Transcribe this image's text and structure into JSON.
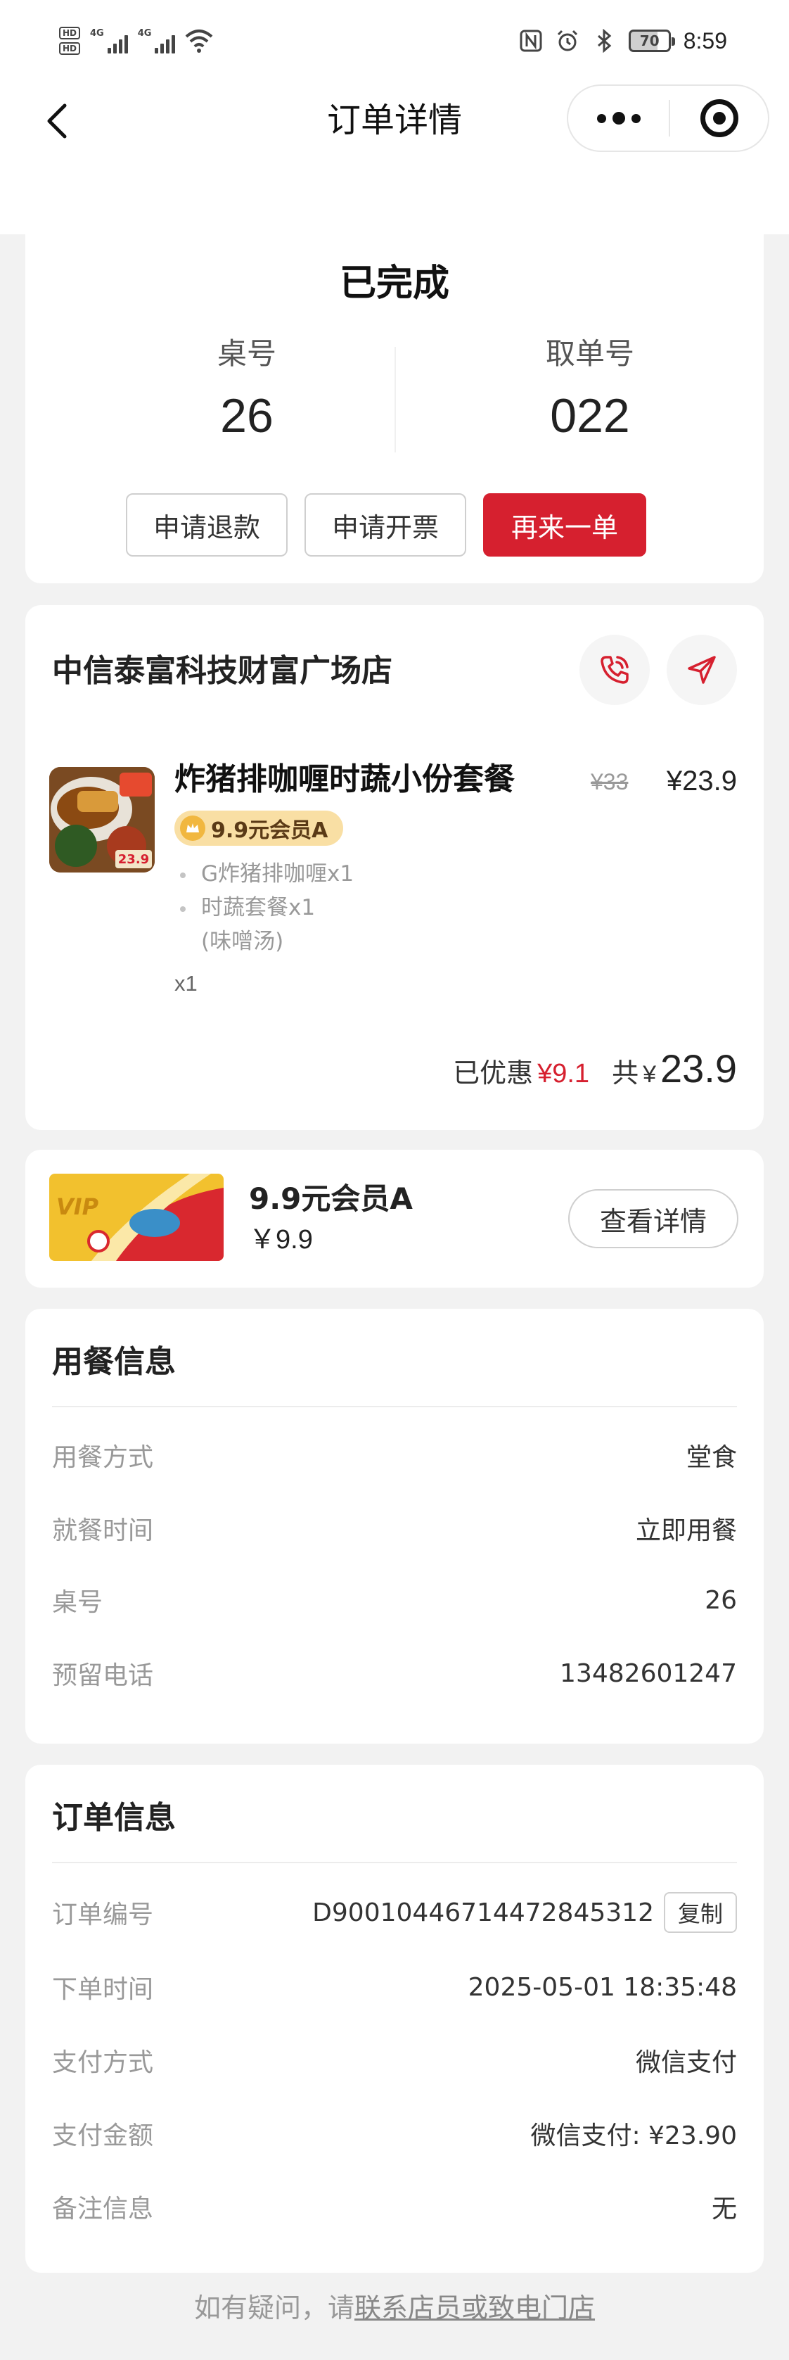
{
  "status_bar": {
    "hd": "HD",
    "net1": "4G",
    "net2": "4G",
    "battery": "70",
    "time": "8:59"
  },
  "nav": {
    "title": "订单详情"
  },
  "order_status": {
    "title": "已完成",
    "table_label": "桌号",
    "table_value": "26",
    "pickup_label": "取单号",
    "pickup_value": "022",
    "buttons": {
      "refund": "申请退款",
      "invoice": "申请开票",
      "reorder": "再来一单"
    }
  },
  "store": {
    "name": "中信泰富科技财富广场店",
    "item": {
      "name": "炸猪排咖喱时蔬小份套餐",
      "original_price": "¥33",
      "price": "¥23.9",
      "member_tag": "9.9元会员A",
      "sub_items": [
        "G炸猪排咖喱x1",
        "时蔬套餐x1"
      ],
      "sub_note": "(味噌汤)",
      "quantity": "x1",
      "thumb_price": "23.9"
    },
    "summary": {
      "discount_label": "已优惠",
      "discount_value": "¥9.1",
      "total_label": "共",
      "currency": "¥",
      "total_value": "23.9"
    }
  },
  "membership": {
    "name": "9.9元会员A",
    "price": "￥9.9",
    "detail_button": "查看详情",
    "badge_text": "VIP"
  },
  "dining_info": {
    "title": "用餐信息",
    "rows": [
      {
        "label": "用餐方式",
        "value": "堂食"
      },
      {
        "label": "就餐时间",
        "value": "立即用餐"
      },
      {
        "label": "桌号",
        "value": "26"
      },
      {
        "label": "预留电话",
        "value": "13482601247"
      }
    ]
  },
  "order_info": {
    "title": "订单信息",
    "rows": [
      {
        "label": "订单编号",
        "value": "D90010446714472845312"
      },
      {
        "label": "下单时间",
        "value": "2025-05-01 18:35:48"
      },
      {
        "label": "支付方式",
        "value": "微信支付"
      },
      {
        "label": "支付金额",
        "value": "微信支付: ¥23.90"
      },
      {
        "label": "备注信息",
        "value": "无"
      }
    ],
    "copy_button": "复制"
  },
  "footer": {
    "prefix": "如有疑问，请",
    "link": "联系店员或致电门店"
  },
  "colors": {
    "accent": "#d6202f",
    "background": "#f2f2f2",
    "member_tag_bg": "#f9dfa4"
  }
}
